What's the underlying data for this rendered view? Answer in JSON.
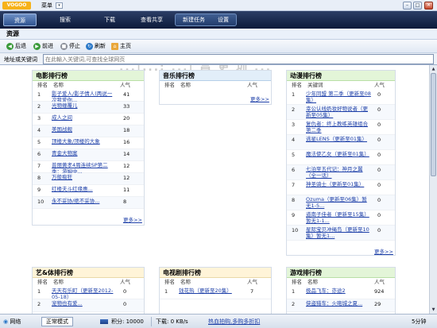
{
  "app": {
    "logo": "VOGOO",
    "menu": "菜单"
  },
  "window_buttons": [
    "–",
    "□",
    "✕"
  ],
  "tabs": [
    {
      "label": "资源",
      "active": true
    },
    {
      "label": "搜索",
      "active": false
    },
    {
      "label": "下载",
      "active": false
    },
    {
      "label": "查看共享",
      "active": false
    },
    {
      "label": "新建任务",
      "active": false
    },
    {
      "label": "设置",
      "active": false
    }
  ],
  "section_title": "资源",
  "nav": {
    "back": "后退",
    "forward": "前进",
    "stop": "停止",
    "refresh": "刷新",
    "home": "主页"
  },
  "address": {
    "label": "地址或关键词",
    "placeholder": "在此輸入关键词,可查找全球网页"
  },
  "banner_text": "...|...: ...| 昌 更 圳 ...",
  "panels": {
    "movie": {
      "title": "电影排行榜",
      "col_rank": "排名",
      "col_name": "名称",
      "col_hot": "人气",
      "more": "更多>>",
      "rows": [
        {
          "rank": "1",
          "name": "影子爱人/影子情人(两说一次我爱你...",
          "hot": "41"
        },
        {
          "rank": "2",
          "name": "光物缠覆儿",
          "hot": "33"
        },
        {
          "rank": "3",
          "name": "成人之间",
          "hot": "20"
        },
        {
          "rank": "4",
          "name": "美国战舰",
          "hot": "18"
        },
        {
          "rank": "5",
          "name": "顶楼大象/顶楼的大象",
          "hot": "16"
        },
        {
          "rank": "6",
          "name": "青金大物案",
          "hot": "14"
        },
        {
          "rank": "7",
          "name": "普丽黄孝4周连续SP第二季：游姆中...",
          "hot": "12"
        },
        {
          "rank": "8",
          "name": "万般痴狂",
          "hot": "12"
        },
        {
          "rank": "9",
          "name": "红楼夫斗红缘惠...",
          "hot": "11"
        },
        {
          "rank": "10",
          "name": "永不妥协/绝不妥协...",
          "hot": "8"
        }
      ]
    },
    "music": {
      "title": "音乐排行榜",
      "col_rank": "排名",
      "col_name": "名称",
      "col_hot": "人气",
      "more": "更多>>"
    },
    "anime": {
      "title": "动漫排行榜",
      "col_rank": "排名",
      "col_name": "关键词",
      "col_hot": "人气",
      "more": "更多>>",
      "rows": [
        {
          "rank": "1",
          "name": "少年同盟 第二季（更新至08集）",
          "hot": "0"
        },
        {
          "rank": "2",
          "name": "幸公认线奶妆好物说者（更新至05集）",
          "hot": "0"
        },
        {
          "rank": "3",
          "name": "复仇者：终上教练英雄组合 第二季",
          "hot": "0"
        },
        {
          "rank": "4",
          "name": "逃星LENS（更新至01集）",
          "hot": "0"
        },
        {
          "rank": "5",
          "name": "魔法使乙女（更新至01集）",
          "hot": "0"
        },
        {
          "rank": "6",
          "name": "七泊至五代记：神月之翼（全一话）",
          "hot": "0"
        },
        {
          "rank": "7",
          "name": "神圣骑士（更新至01集）",
          "hot": "0"
        },
        {
          "rank": "8",
          "name": "Ozuma（更新至06集）暂无1-5...",
          "hot": "0"
        },
        {
          "rank": "9",
          "name": "道南子佳者（更新至15集）暂无1-1...",
          "hot": "0"
        },
        {
          "rank": "10",
          "name": "星际宝贝冲绳岛（更新至10集）暂无1...",
          "hot": "0"
        }
      ]
    },
    "variety": {
      "title": "艺&体排行榜",
      "col_rank": "排名",
      "col_name": "名称",
      "col_hot": "人气",
      "rows": [
        {
          "rank": "1",
          "name": "天天有乐町（更新至2012-05-18）",
          "hot": "0"
        },
        {
          "rank": "2",
          "name": "宠物也有爱...",
          "hot": "0"
        }
      ]
    },
    "tv": {
      "title": "电视剧排行榜",
      "col_rank": "排名",
      "col_name": "名称",
      "col_hot": "人气",
      "rows": [
        {
          "rank": "1",
          "name": "钱花热（更新至20集）",
          "hot": "7"
        }
      ]
    },
    "game": {
      "title": "游戏排行榜",
      "col_rank": "排名",
      "col_name": "名称",
      "col_hot": "人气",
      "rows": [
        {
          "rank": "1",
          "name": "极品飞车：亦途2",
          "hot": "924"
        },
        {
          "rank": "2",
          "name": "侠盗猎车：火砲城之夏...",
          "hot": "29"
        }
      ]
    }
  },
  "status": {
    "network": "网络",
    "mode": "正常模式",
    "points": "积分: 10000",
    "speed": "下载: 0 KB/s",
    "promo": "热血拍购,多购多折扣",
    "version": "5分钟"
  }
}
